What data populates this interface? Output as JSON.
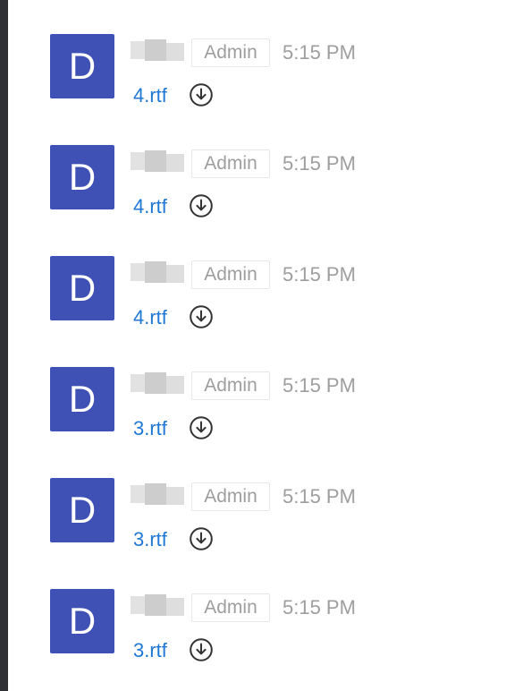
{
  "messages": [
    {
      "avatar_letter": "D",
      "role_badge": "Admin",
      "time": "5:15 PM",
      "file_name": "4.rtf"
    },
    {
      "avatar_letter": "D",
      "role_badge": "Admin",
      "time": "5:15 PM",
      "file_name": "4.rtf"
    },
    {
      "avatar_letter": "D",
      "role_badge": "Admin",
      "time": "5:15 PM",
      "file_name": "4.rtf"
    },
    {
      "avatar_letter": "D",
      "role_badge": "Admin",
      "time": "5:15 PM",
      "file_name": "3.rtf"
    },
    {
      "avatar_letter": "D",
      "role_badge": "Admin",
      "time": "5:15 PM",
      "file_name": "3.rtf"
    },
    {
      "avatar_letter": "D",
      "role_badge": "Admin",
      "time": "5:15 PM",
      "file_name": "3.rtf"
    }
  ],
  "colors": {
    "avatar_background": "#3f51b5",
    "link": "#1e78d6",
    "muted_text": "#9e9e9e",
    "left_rail": "#2f3033"
  },
  "icons": {
    "download": "download-circle-icon"
  }
}
